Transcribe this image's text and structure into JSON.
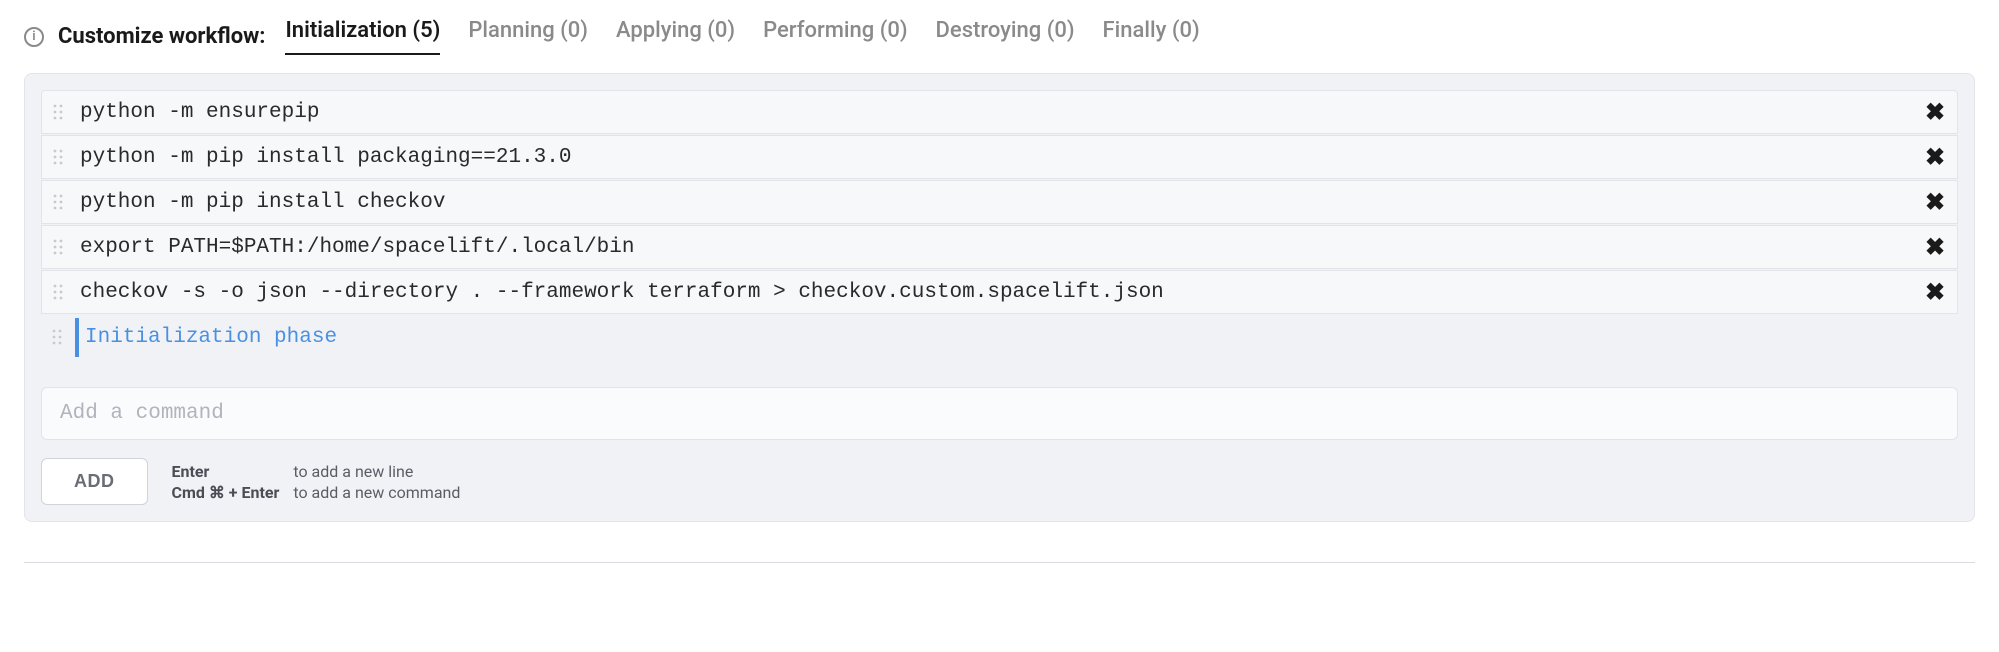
{
  "header": {
    "label": "Customize workflow:"
  },
  "tabs": [
    {
      "label": "Initialization (5)",
      "active": true
    },
    {
      "label": "Planning (0)",
      "active": false
    },
    {
      "label": "Applying (0)",
      "active": false
    },
    {
      "label": "Performing (0)",
      "active": false
    },
    {
      "label": "Destroying (0)",
      "active": false
    },
    {
      "label": "Finally (0)",
      "active": false
    }
  ],
  "commands": [
    "python -m ensurepip",
    "python -m pip install packaging==21.3.0",
    "python -m pip install checkov",
    "export PATH=$PATH:/home/spacelift/.local/bin",
    "checkov -s -o json --directory . --framework terraform > checkov.custom.spacelift.json"
  ],
  "editing_text": "Initialization phase",
  "add_placeholder": "Add a command",
  "add_button_label": "ADD",
  "hints": {
    "key1": "Enter",
    "desc1": "to add a new line",
    "key2": "Cmd ⌘ + Enter",
    "desc2": "to add a new command"
  }
}
